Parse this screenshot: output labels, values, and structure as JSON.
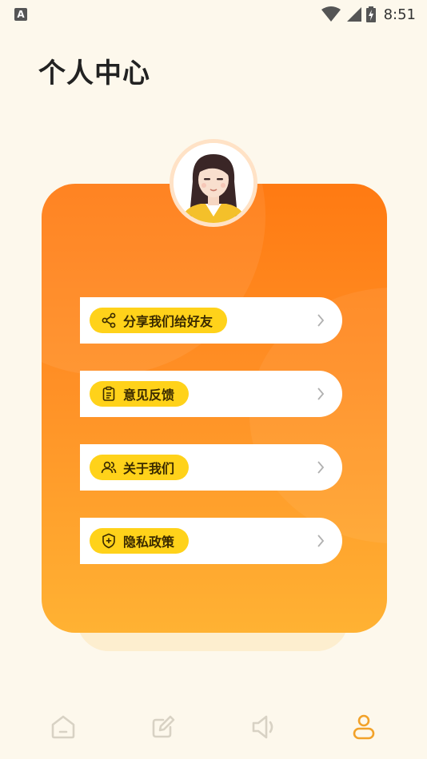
{
  "status_bar": {
    "notification_icon": "A",
    "time": "8:51",
    "icons": [
      "wifi-icon",
      "cell-signal-icon",
      "battery-charging-icon"
    ]
  },
  "page": {
    "title": "个人中心"
  },
  "menu": {
    "items": [
      {
        "label": "分享我们给好友",
        "icon": "share-icon"
      },
      {
        "label": "意见反馈",
        "icon": "clipboard-icon"
      },
      {
        "label": "关于我们",
        "icon": "users-icon"
      },
      {
        "label": "隐私政策",
        "icon": "shield-plus-icon"
      }
    ]
  },
  "nav": {
    "items": [
      {
        "icon": "home-icon",
        "active": false
      },
      {
        "icon": "edit-icon",
        "active": false
      },
      {
        "icon": "speaker-icon",
        "active": false
      },
      {
        "icon": "user-icon",
        "active": true
      }
    ]
  },
  "colors": {
    "background": "#FDF8EC",
    "card_top": "#FF7A12",
    "card_bottom": "#FFB233",
    "pill": "#FFD21A",
    "nav_inactive": "#D8D2C4",
    "nav_active": "#F2A229"
  }
}
